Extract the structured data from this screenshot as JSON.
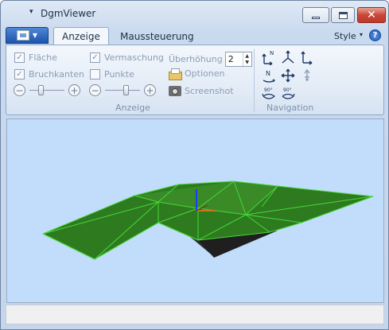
{
  "window": {
    "title": "DgmViewer",
    "menu_arrow": "▾"
  },
  "tabs": [
    {
      "label": "Anzeige",
      "active": true
    },
    {
      "label": "Maussteuerung",
      "active": false
    }
  ],
  "style_menu": {
    "label": "Style",
    "caret": "▾"
  },
  "help_icon": "?",
  "anzeige_group": {
    "label": "Anzeige",
    "checkboxes": [
      {
        "label": "Fläche",
        "checked": true
      },
      {
        "label": "Bruchkanten",
        "checked": true
      },
      {
        "label": "Vermaschung",
        "checked": true
      },
      {
        "label": "Punkte",
        "checked": false
      }
    ],
    "zoom_minus": "−",
    "zoom_plus": "+",
    "slider1_position": 0.3,
    "slider2_position": 0.55,
    "ueberhoehung_label": "Überhöhung",
    "ueberhoehung_value": "2",
    "optionen_label": "Optionen",
    "screenshot_label": "Screenshot"
  },
  "navigation_group": {
    "label": "Navigation",
    "icons": [
      "view-north-left-icon",
      "view-axes-center-icon",
      "view-axes-right-icon",
      "view-north-icon",
      "pan-move-icon",
      "zoom-extent-icon",
      "rotate-90-left-icon",
      "rotate-90-right-icon"
    ],
    "rotate_left_text": "90°",
    "rotate_right_text": "90°",
    "north_text": "N"
  },
  "colors": {
    "viewport_bg": "#c2dcfb",
    "surface_fill": "#2e7a1f",
    "mesh_lines": "#4ade3a",
    "underside": "#2a2a2a"
  }
}
